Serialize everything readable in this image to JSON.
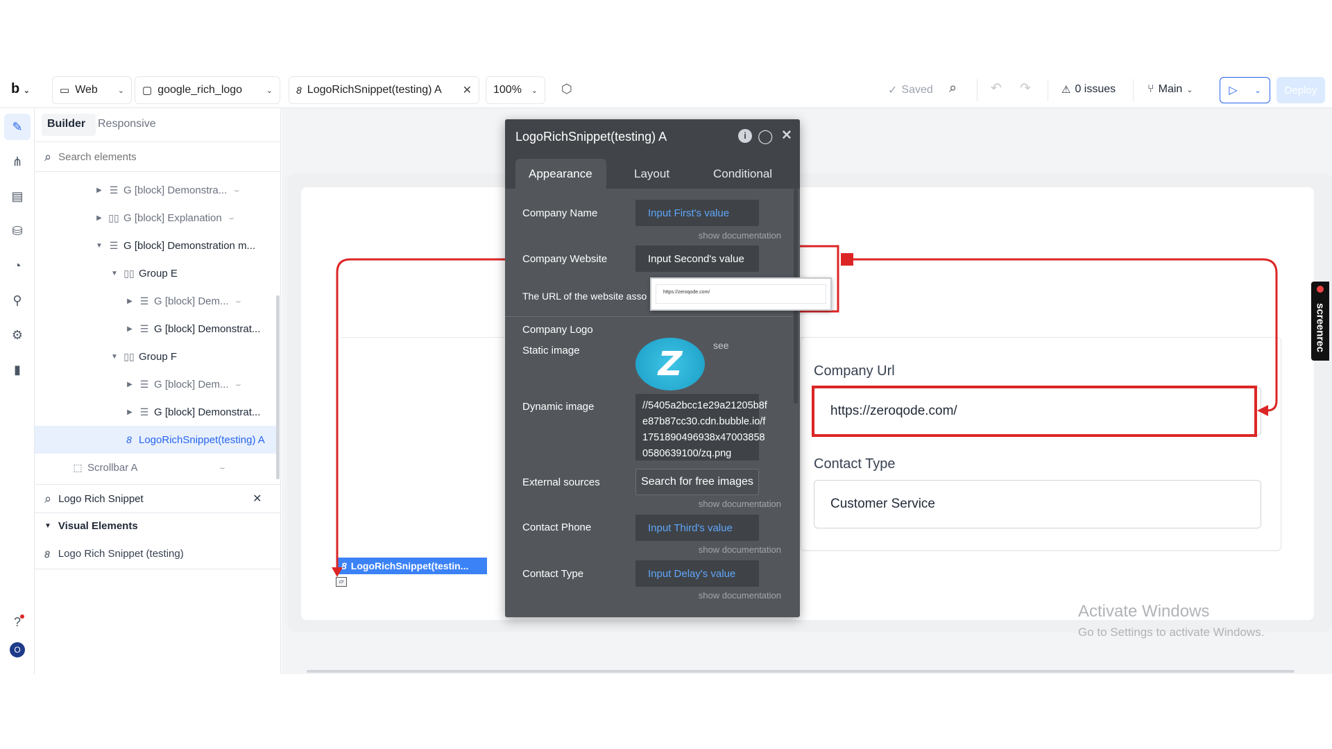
{
  "toolbar": {
    "logo": "b",
    "platform": "Web",
    "page": "google_rich_logo",
    "element_tab": "LogoRichSnippet(testing) A",
    "element_badge": "8",
    "zoom": "100%",
    "saved": "Saved",
    "issues": "0 issues",
    "branch": "Main",
    "deploy": "Deploy"
  },
  "panel": {
    "tabs": [
      "Builder",
      "Responsive"
    ],
    "search_placeholder": "Search elements",
    "tree": [
      {
        "label": "G [block] Demonstra...",
        "indent": 1,
        "toggle": "▶",
        "icon": "☰",
        "hidden": true
      },
      {
        "label": "G [block] Explanation",
        "indent": 1,
        "toggle": "▶",
        "icon": "▯▯",
        "hidden": true
      },
      {
        "label": "G [block] Demonstration m...",
        "indent": 1,
        "toggle": "▼",
        "icon": "☰",
        "hidden": false
      },
      {
        "label": "Group E",
        "indent": 2,
        "toggle": "▼",
        "icon": "▯▯",
        "hidden": false
      },
      {
        "label": "G [block] Dem...",
        "indent": 3,
        "toggle": "▶",
        "icon": "☰",
        "hidden": true
      },
      {
        "label": "G [block] Demonstrat...",
        "indent": 3,
        "toggle": "▶",
        "icon": "☰",
        "hidden": false
      },
      {
        "label": "Group F",
        "indent": 2,
        "toggle": "▼",
        "icon": "▯▯",
        "hidden": false
      },
      {
        "label": "G [block] Dem...",
        "indent": 3,
        "toggle": "▶",
        "icon": "☰",
        "hidden": true
      },
      {
        "label": "G [block] Demonstrat...",
        "indent": 3,
        "toggle": "▶",
        "icon": "☰",
        "hidden": false
      },
      {
        "label": "LogoRichSnippet(testing) A",
        "indent": 2,
        "toggle": "",
        "icon": "8",
        "hidden": false,
        "selected": true
      },
      {
        "label": "Scrollbar A",
        "indent": 1,
        "toggle": "",
        "icon": "⬚",
        "hidden": true
      }
    ],
    "plugin_search_value": "Logo Rich Snippet",
    "section_title": "Visual Elements",
    "plugin_item_badge": "8",
    "plugin_item": "Logo Rich Snippet (testing)"
  },
  "editor": {
    "title": "LogoRichSnippet(testing) A",
    "tabs": [
      "Appearance",
      "Layout",
      "Conditional"
    ],
    "company_name_label": "Company Name",
    "company_name_value": "Input First's value",
    "show_documentation": "show documentation",
    "company_website_label": "Company Website",
    "company_website_value": "Input Second's value",
    "website_desc": "The URL of the website asso",
    "tooltip_url": "https://zeroqode.com/",
    "company_logo_label": "Company Logo",
    "static_image_label": "Static image",
    "see": "see",
    "dynamic_image_label": "Dynamic image",
    "dynamic_image_value": [
      "//5405a2bcc1e29a21205b8f",
      "e87b87cc30.cdn.bubble.io/f",
      "1751890496938x47003858",
      "0580639100/zq.png"
    ],
    "external_sources_label": "External sources",
    "external_sources_button": "Search for free images",
    "contact_phone_label": "Contact Phone",
    "contact_phone_value": "Input Third's value",
    "contact_type_label": "Contact Type",
    "contact_type_value": "Input Delay's value"
  },
  "canvas": {
    "company_url_label": "Company Url",
    "company_url_value": "https://zeroqode.com/",
    "contact_type_label": "Contact Type",
    "contact_type_value": "Customer Service",
    "element_label": "LogoRichSnippet(testin...",
    "element_badge": "8",
    "activate_title": "Activate Windows",
    "activate_sub": "Go to Settings to activate Windows.",
    "screen_recorder": "screenrec"
  },
  "colors": {
    "accent_blue": "#2563eb",
    "highlight_red": "#dc2626",
    "editor_bg": "#53575c",
    "link_blue": "#60a5fa"
  }
}
